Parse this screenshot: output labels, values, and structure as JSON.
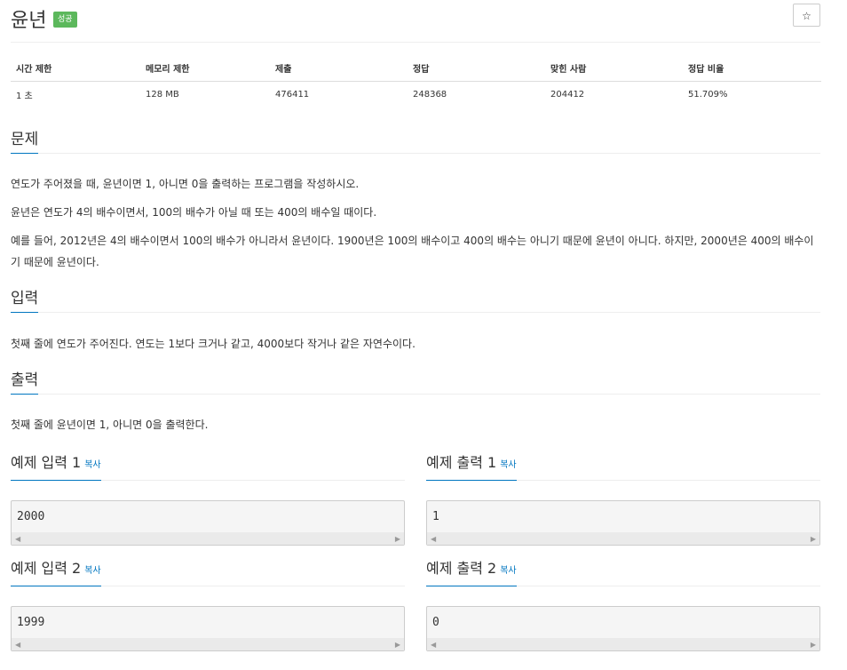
{
  "problem": {
    "title": "윤년",
    "badge": "성공",
    "star_icon": "☆"
  },
  "stats": {
    "headers": [
      "시간 제한",
      "메모리 제한",
      "제출",
      "정답",
      "맞힌 사람",
      "정답 비율"
    ],
    "values": [
      "1 초",
      "128 MB",
      "476411",
      "248368",
      "204412",
      "51.709%"
    ]
  },
  "sections": {
    "problem_heading": "문제",
    "problem_paragraphs": [
      "연도가 주어졌을 때, 윤년이면 1, 아니면 0을 출력하는 프로그램을 작성하시오.",
      "윤년은 연도가 4의 배수이면서, 100의 배수가 아닐 때 또는 400의 배수일 때이다.",
      "예를 들어, 2012년은 4의 배수이면서 100의 배수가 아니라서 윤년이다. 1900년은 100의 배수이고 400의 배수는 아니기 때문에 윤년이 아니다. 하지만, 2000년은 400의 배수이기 때문에 윤년이다."
    ],
    "input_heading": "입력",
    "input_text": "첫째 줄에 연도가 주어진다. 연도는 1보다 크거나 같고, 4000보다 작거나 같은 자연수이다.",
    "output_heading": "출력",
    "output_text": "첫째 줄에 윤년이면 1, 아니면 0을 출력한다."
  },
  "samples": {
    "copy_label": "복사",
    "input1_title": "예제 입력 1",
    "input1_value": "2000",
    "output1_title": "예제 출력 1",
    "output1_value": "1",
    "input2_title": "예제 입력 2",
    "input2_value": "1999",
    "output2_title": "예제 출력 2",
    "output2_value": "0"
  }
}
